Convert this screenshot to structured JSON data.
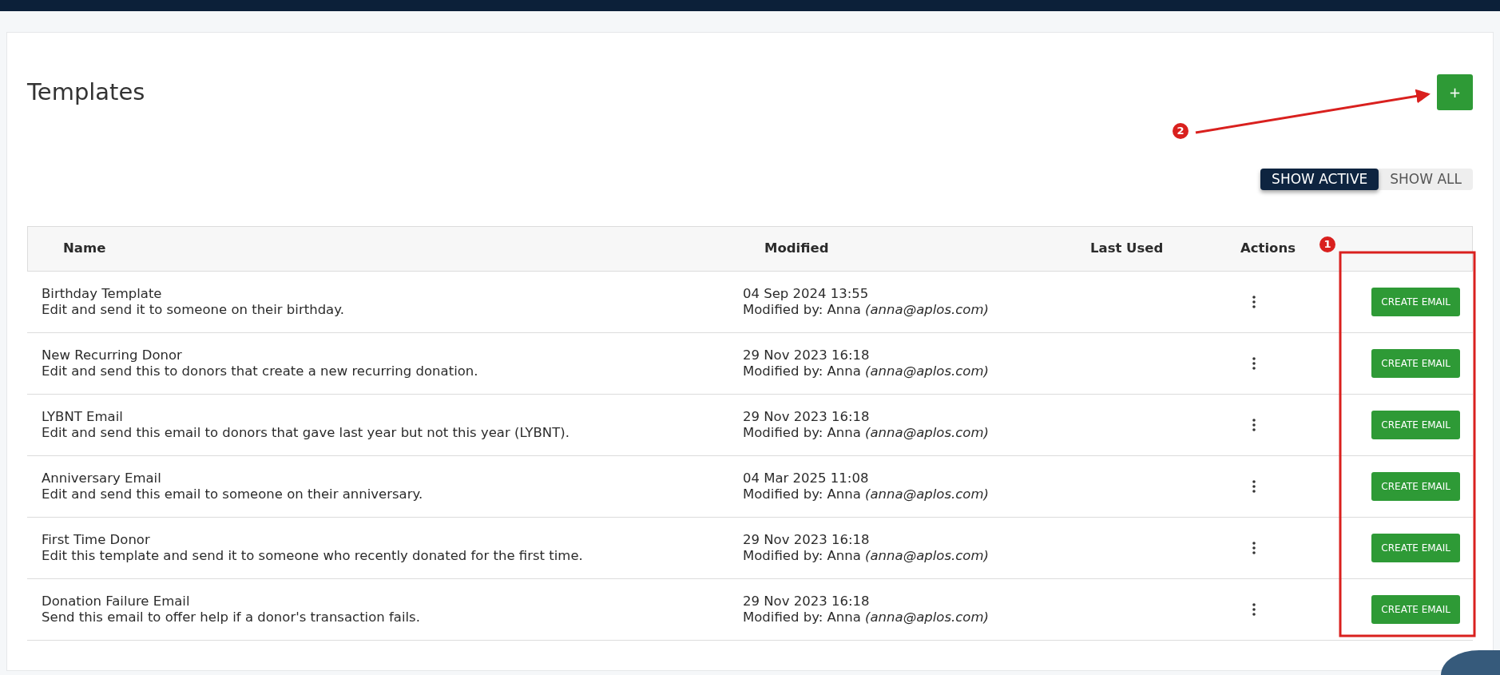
{
  "page": {
    "title": "Templates"
  },
  "add_button": {
    "label": "+"
  },
  "filter_toggle": [
    {
      "label": "SHOW ACTIVE",
      "selected": true
    },
    {
      "label": "SHOW ALL",
      "selected": false
    }
  ],
  "table": {
    "columns": [
      "Name",
      "Modified",
      "Last Used",
      "Actions"
    ],
    "rows": [
      {
        "name": "Birthday Template",
        "description": "Edit and send it to someone on their birthday.",
        "modified": "04 Sep 2024 13:55",
        "modified_by": "Modified by: Anna *(anna@aplos.com)*",
        "button": "CREATE EMAIL"
      },
      {
        "name": "New Recurring Donor",
        "description": "Edit and send this to donors that create a new recurring donation.",
        "modified": "29 Nov 2023 16:18",
        "modified_by": "Modified by: Anna *(anna@aplos.com)*",
        "button": "CREATE EMAIL"
      },
      {
        "name": "LYBNT Email",
        "description": "Edit and send this email to donors that gave last year but not this year (LYBNT).",
        "modified": "29 Nov 2023 16:18",
        "modified_by": "Modified by: Anna *(anna@aplos.com)*",
        "button": "CREATE EMAIL"
      },
      {
        "name": "Anniversary Email",
        "description": "Edit and send this email to someone on their anniversary.",
        "modified": "04 Mar 2025 11:08",
        "modified_by": "Modified by: Anna *(anna@aplos.com)*",
        "button": "CREATE EMAIL"
      },
      {
        "name": "First Time Donor",
        "description": "Edit this template and send it to someone who recently donated for the first time.",
        "modified": "29 Nov 2023 16:18",
        "modified_by": "Modified by: Anna *(anna@aplos.com)*",
        "button": "CREATE EMAIL"
      },
      {
        "name": "Donation Failure Email",
        "description": "Send this email to offer help if a donor's transaction fails.",
        "modified": "29 Nov 2023 16:18",
        "modified_by": "Modified by: Anna *(anna@aplos.com)*",
        "button": "CREATE EMAIL"
      }
    ]
  },
  "annotations": [
    {
      "label": "1"
    },
    {
      "label": "2"
    }
  ]
}
